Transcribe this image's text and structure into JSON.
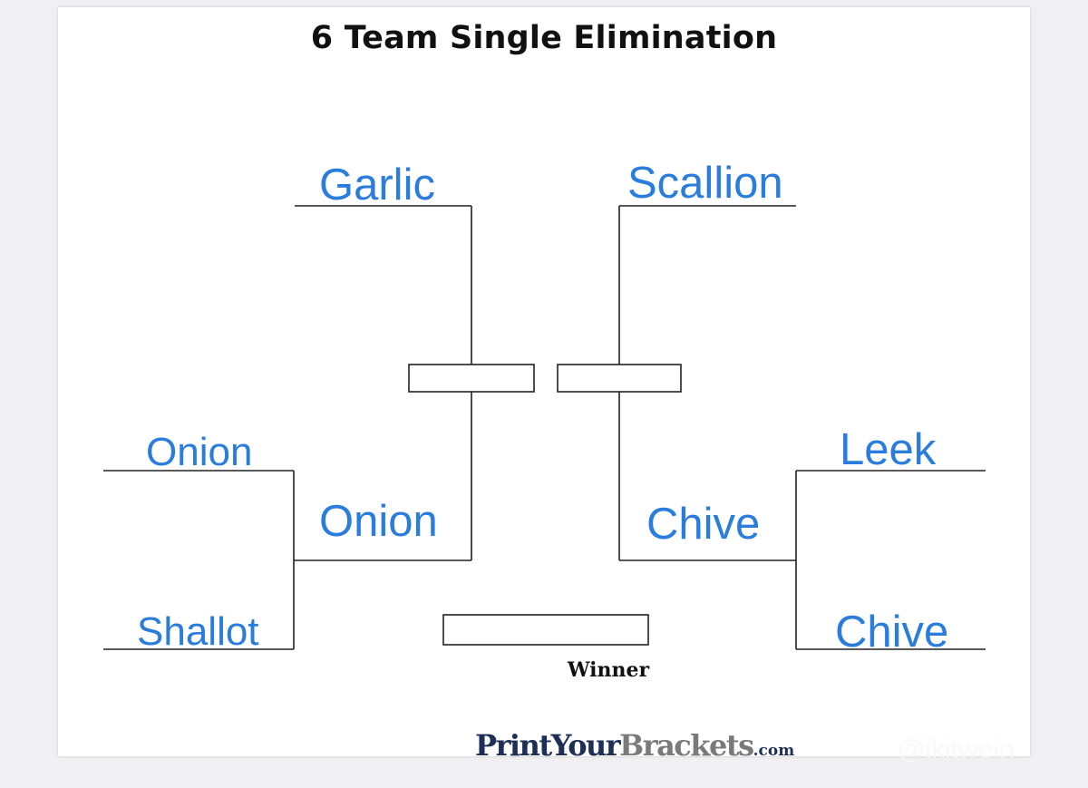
{
  "title": "6 Team Single Elimination",
  "colors": {
    "team_text": "#2a7ddd",
    "lines": "#222222",
    "title_text": "#111111",
    "brand_dark": "#1d2e57",
    "brand_gray": "#7a7a7a"
  },
  "bracket": {
    "left": {
      "bye_team": "Garlic",
      "round1_top": "Onion",
      "round1_bottom": "Shallot",
      "round1_winner": "Onion",
      "semifinal_winner": ""
    },
    "right": {
      "bye_team": "Scallion",
      "round1_top": "Leek",
      "round1_bottom": "Chive",
      "round1_winner": "Chive",
      "semifinal_winner": ""
    },
    "champion": "",
    "winner_label": "Winner"
  },
  "branding": {
    "part1": "PrintYour",
    "part2": "Brackets",
    "part3": ".com"
  },
  "watermark": "@ikitwein"
}
